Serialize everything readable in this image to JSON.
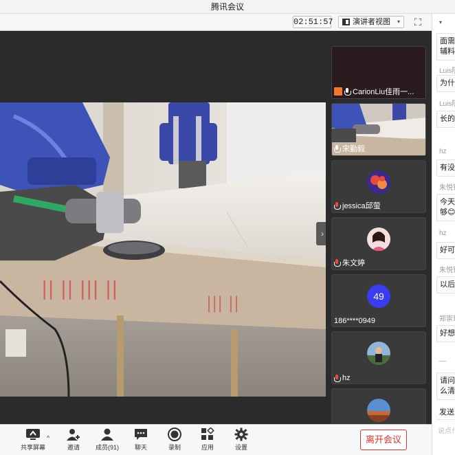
{
  "window": {
    "title": "腾讯会议"
  },
  "topbar": {
    "timer": "02:51:57",
    "view_label": "演讲者视图",
    "view_caret": "▾",
    "fullscreen_glyph": "⛶"
  },
  "gallery": {
    "tiles": [
      {
        "name": "CarionLiu佳雨一..."
      },
      {
        "name": "宋勤毅"
      },
      {
        "name": "jessica邱萤"
      },
      {
        "name": "朱文婷"
      },
      {
        "name": "186****0949",
        "avatar_text": "49"
      },
      {
        "name": "hz"
      }
    ]
  },
  "chat": {
    "messages": [
      {
        "text": "面需\n辅料"
      },
      {
        "sender": "Luis阮",
        "text": "为什"
      },
      {
        "sender": "Luis阮",
        "text": "长的"
      },
      {
        "sender": "hz",
        "text": "有没"
      },
      {
        "sender": "朱悦镇",
        "text": "今天\n够😊"
      },
      {
        "sender": "hz",
        "text": "好可"
      },
      {
        "sender": "朱悦镇",
        "text": "以后"
      },
      {
        "sender": "郑崇玮",
        "text": "好想"
      },
      {
        "text": "请问\n么清"
      }
    ],
    "dash": "—",
    "send_to": "发送到",
    "input_placeholder": "说点什"
  },
  "toolbar": {
    "share": "共享屏幕",
    "invite": "邀请",
    "members": "成员(91)",
    "chat": "聊天",
    "record": "录制",
    "apps": "应用",
    "settings": "设置",
    "leave": "离开会议",
    "share_caret": "^"
  },
  "colors": {
    "leave_red": "#e0322f",
    "stage_bg": "#2b2b2b",
    "avatar_blue": "#3b3bf0",
    "host_orange": "#f07a2b"
  }
}
